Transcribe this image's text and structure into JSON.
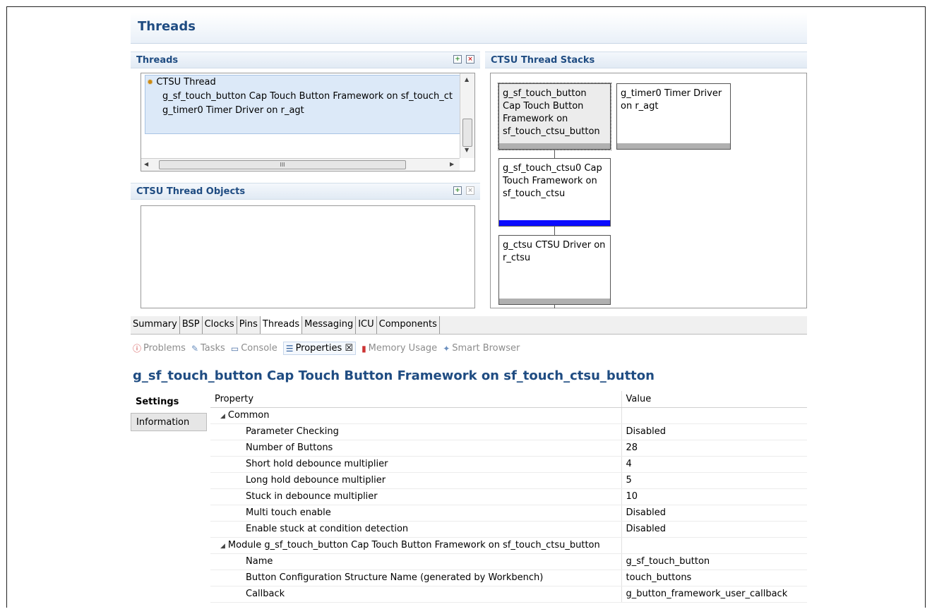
{
  "page_title": "Threads",
  "threads_section": {
    "title": "Threads",
    "tree": [
      {
        "label": "CTSU Thread",
        "level": 0
      },
      {
        "label": "g_sf_touch_button Cap Touch Button Framework on sf_touch_ct",
        "level": 1
      },
      {
        "label": "g_timer0 Timer Driver on r_agt",
        "level": 1
      }
    ],
    "hscroll_grip": "III"
  },
  "objects_section": {
    "title": "CTSU Thread Objects"
  },
  "stacks_section": {
    "title": "CTSU Thread Stacks",
    "stacks": [
      {
        "label": "g_sf_touch_button Cap Touch Button Framework on sf_touch_ctsu_button"
      },
      {
        "label": "g_timer0 Timer Driver on r_agt"
      },
      {
        "label": "g_sf_touch_ctsu0 Cap Touch Framework on sf_touch_ctsu"
      },
      {
        "label": "g_ctsu CTSU Driver on r_ctsu"
      }
    ]
  },
  "editor_tabs": [
    "Summary",
    "BSP",
    "Clocks",
    "Pins",
    "Threads",
    "Messaging",
    "ICU",
    "Components"
  ],
  "active_editor_tab": "Threads",
  "views": [
    {
      "label": "Problems",
      "icon": "problems-icon"
    },
    {
      "label": "Tasks",
      "icon": "tasks-icon"
    },
    {
      "label": "Console",
      "icon": "console-icon"
    },
    {
      "label": "Properties ☒",
      "icon": "properties-icon",
      "active": true
    },
    {
      "label": "Memory Usage",
      "icon": "memory-icon"
    },
    {
      "label": "Smart Browser",
      "icon": "smart-browser-icon"
    }
  ],
  "properties": {
    "title": "g_sf_touch_button Cap Touch Button Framework on sf_touch_ctsu_button",
    "side_tabs": [
      "Settings",
      "Information"
    ],
    "columns": {
      "property": "Property",
      "value": "Value"
    },
    "rows": [
      {
        "property": "Common",
        "value": "",
        "group": true
      },
      {
        "property": "Parameter Checking",
        "value": "Disabled"
      },
      {
        "property": "Number of Buttons",
        "value": "28"
      },
      {
        "property": "Short hold debounce multiplier",
        "value": "4"
      },
      {
        "property": "Long hold debounce multiplier",
        "value": "5"
      },
      {
        "property": "Stuck in debounce multiplier",
        "value": "10"
      },
      {
        "property": "Multi touch enable",
        "value": "Disabled"
      },
      {
        "property": "Enable stuck at condition detection",
        "value": "Disabled"
      },
      {
        "property": "Module g_sf_touch_button Cap Touch Button Framework on sf_touch_ctsu_button",
        "value": "",
        "group": true
      },
      {
        "property": "Name",
        "value": "g_sf_touch_button"
      },
      {
        "property": "Button Configuration Structure Name (generated by Workbench)",
        "value": "touch_buttons"
      },
      {
        "property": "Callback",
        "value": "g_button_framework_user_callback"
      }
    ]
  }
}
